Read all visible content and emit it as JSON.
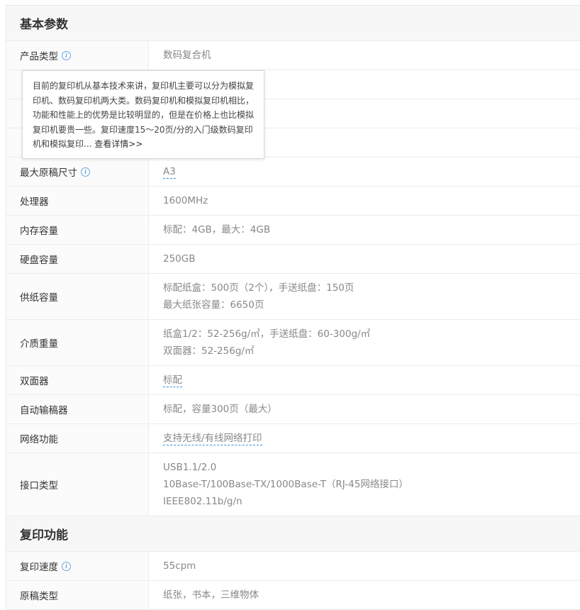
{
  "sections": [
    {
      "title": "基本参数",
      "rows": [
        {
          "label": "产品类型",
          "info": true,
          "lines": [
            "数码复合机"
          ]
        },
        {
          "label": "",
          "lines": [
            ""
          ]
        },
        {
          "label": "",
          "lines": [
            ""
          ]
        },
        {
          "label": "",
          "lines": [
            ""
          ]
        },
        {
          "label": "最大原稿尺寸",
          "info": true,
          "lines": [
            "A3"
          ],
          "link": true
        },
        {
          "label": "处理器",
          "lines": [
            "1600MHz"
          ]
        },
        {
          "label": "内存容量",
          "lines": [
            "标配：4GB，最大：4GB"
          ]
        },
        {
          "label": "硬盘容量",
          "lines": [
            "250GB"
          ]
        },
        {
          "label": "供纸容量",
          "lines": [
            "标配纸盒：500页（2个），手送纸盘：150页",
            "最大纸张容量：6650页"
          ]
        },
        {
          "label": "介质重量",
          "lines": [
            "纸盒1/2：52-256g/㎡，手送纸盘：60-300g/㎡",
            "双面器：52-256g/㎡"
          ]
        },
        {
          "label": "双面器",
          "lines": [
            "标配"
          ],
          "link": true
        },
        {
          "label": "自动输稿器",
          "lines": [
            "标配，容量300页（最大）"
          ]
        },
        {
          "label": "网络功能",
          "lines": [
            "支持无线/有线网络打印"
          ],
          "link": true
        },
        {
          "label": "接口类型",
          "lines": [
            "USB1.1/2.0",
            "10Base-T/100Base-TX/1000Base-T（RJ-45网络接口）",
            "IEEE802.11b/g/n"
          ]
        }
      ]
    },
    {
      "title": "复印功能",
      "rows": [
        {
          "label": "复印速度",
          "info": true,
          "lines": [
            "55cpm"
          ]
        },
        {
          "label": "原稿类型",
          "lines": [
            "纸张，书本，三维物体"
          ]
        }
      ]
    }
  ],
  "tooltip": {
    "text": "目前的复印机从基本技术来讲，复印机主要可以分为模拟复印机、数码复印机两大类。数码复印机和模拟复印机相比，功能和性能上的优势是比较明显的，但是在价格上也比模拟复印机要贵一些。复印速度15～20页/分的入门级数码复印机和模拟复印...",
    "more": " 查看详情>>"
  },
  "icons": {
    "info": "info-circle-icon"
  },
  "colors": {
    "accent": "#3b8fd6",
    "value_text": "#888888",
    "label_bg": "#fbfbfb"
  }
}
